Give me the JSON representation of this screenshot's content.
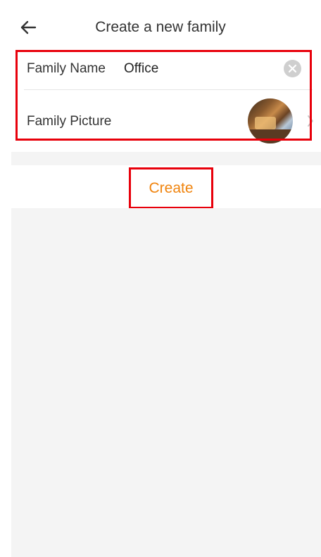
{
  "header": {
    "title": "Create a new family",
    "back_icon": "arrow-left-icon"
  },
  "form": {
    "family_name_label": "Family Name",
    "family_name_value": "Office",
    "clear_icon": "clear-circle-icon",
    "family_picture_label": "Family Picture",
    "picture_chevron_icon": "chevron-right-icon"
  },
  "actions": {
    "create_label": "Create"
  },
  "colors": {
    "accent": "#f0840e",
    "highlight": "#e8000b",
    "background": "#f4f4f4",
    "text": "#333333"
  }
}
